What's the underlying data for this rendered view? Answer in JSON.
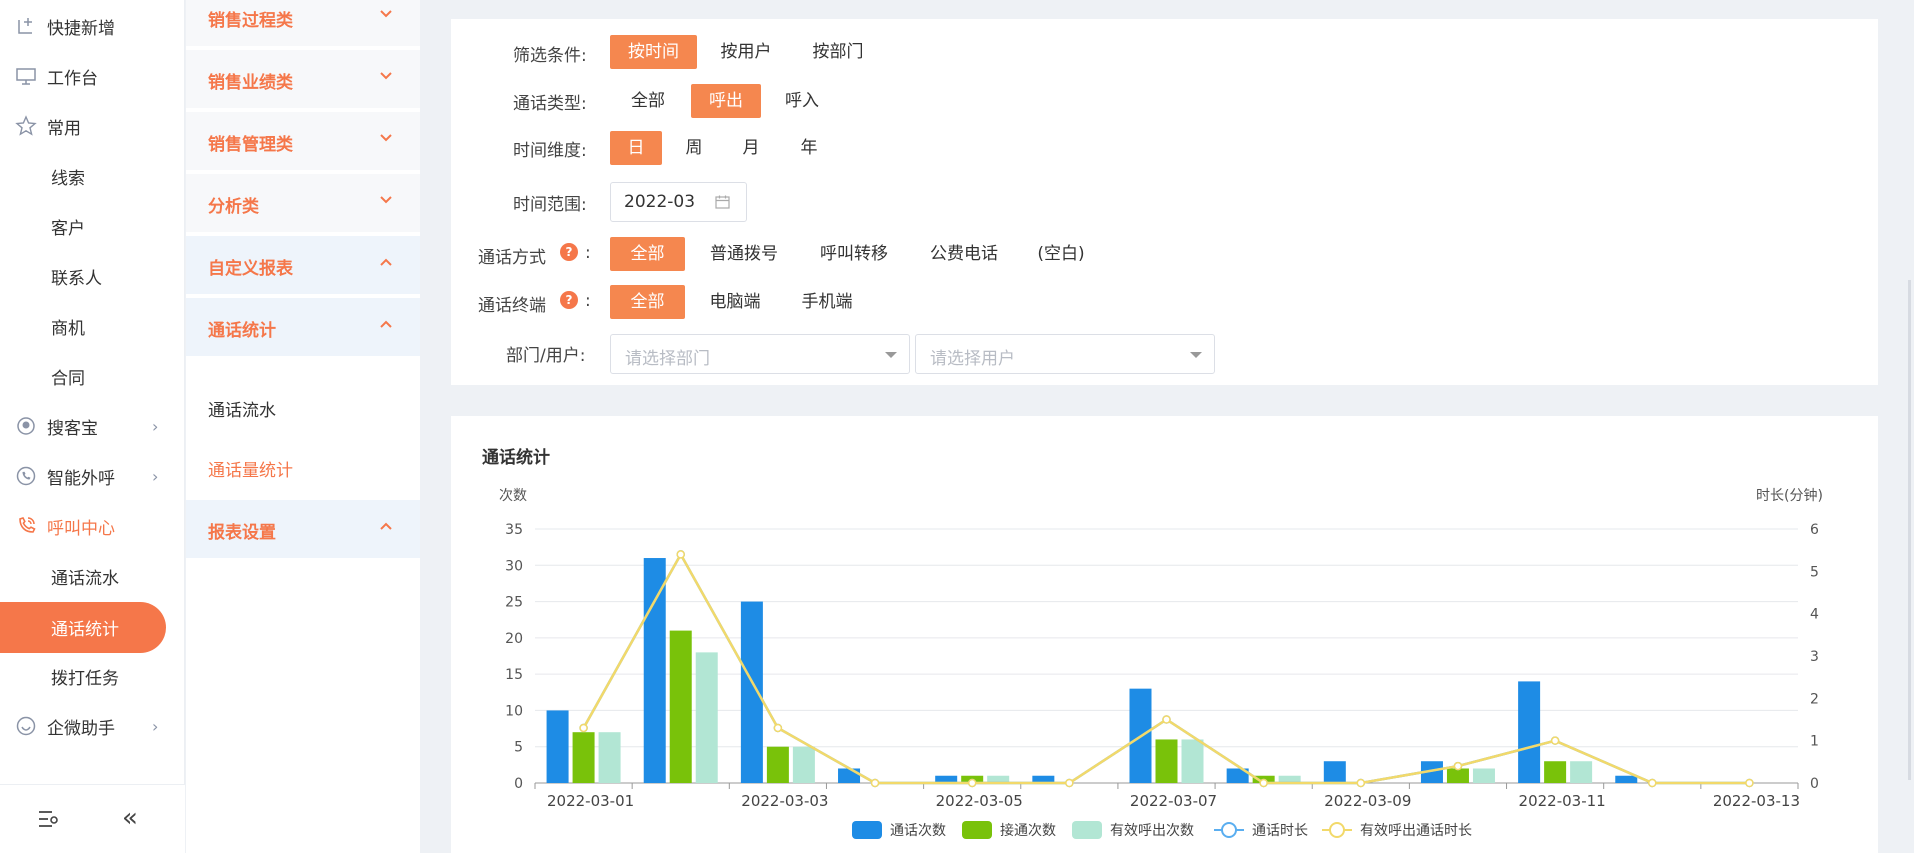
{
  "nav": {
    "items": [
      {
        "label": "快捷新增",
        "icon": "add-doc-icon"
      },
      {
        "label": "工作台",
        "icon": "monitor-icon"
      },
      {
        "label": "常用",
        "icon": "star-icon"
      },
      {
        "label": "线索"
      },
      {
        "label": "客户"
      },
      {
        "label": "联系人"
      },
      {
        "label": "商机"
      },
      {
        "label": "合同"
      },
      {
        "label": "搜客宝",
        "icon": "search-treasure-icon",
        "arrow": "›"
      },
      {
        "label": "智能外呼",
        "icon": "phone-icon",
        "arrow": "›"
      },
      {
        "label": "呼叫中心",
        "icon": "call-center-icon"
      },
      {
        "label": "通话流水"
      },
      {
        "label": "通话统计"
      },
      {
        "label": "拨打任务"
      },
      {
        "label": "企微助手",
        "icon": "wecom-icon",
        "arrow": "›"
      }
    ]
  },
  "panel": {
    "categories": [
      {
        "label": "销售过程类",
        "state": "collapsed"
      },
      {
        "label": "销售业绩类",
        "state": "collapsed"
      },
      {
        "label": "销售管理类",
        "state": "collapsed"
      },
      {
        "label": "分析类",
        "state": "collapsed"
      },
      {
        "label": "自定义报表",
        "state": "expanded"
      },
      {
        "label": "通话统计",
        "state": "expanded"
      },
      {
        "label": "报表设置",
        "state": "expanded"
      }
    ],
    "sub_items": [
      "通话流水",
      "通话量统计"
    ]
  },
  "filters": {
    "condition": {
      "label": "筛选条件:",
      "options": [
        "按时间",
        "按用户",
        "按部门"
      ],
      "selected": "按时间"
    },
    "call_type": {
      "label": "通话类型:",
      "options": [
        "全部",
        "呼出",
        "呼入"
      ],
      "selected": "呼出"
    },
    "time_dim": {
      "label": "时间维度:",
      "options": [
        "日",
        "周",
        "月",
        "年"
      ],
      "selected": "日"
    },
    "time_range": {
      "label": "时间范围:",
      "value": "2022-03"
    },
    "call_method": {
      "label": "通话方式",
      "options": [
        "全部",
        "普通拨号",
        "呼叫转移",
        "公费电话",
        "(空白)"
      ],
      "selected": "全部"
    },
    "call_terminal": {
      "label": "通话终端",
      "options": [
        "全部",
        "电脑端",
        "手机端"
      ],
      "selected": "全部"
    },
    "dept_user": {
      "label": "部门/用户:",
      "dept_placeholder": "请选择部门",
      "user_placeholder": "请选择用户"
    },
    "colon": ":",
    "help": "?"
  },
  "chart_title": "通话统计",
  "chart_data": {
    "type": "bar",
    "x": [
      "2022-03-01",
      "2022-03-02",
      "2022-03-03",
      "2022-03-04",
      "2022-03-05",
      "2022-03-06",
      "2022-03-07",
      "2022-03-08",
      "2022-03-09",
      "2022-03-10",
      "2022-03-11",
      "2022-03-12",
      "2022-03-13"
    ],
    "x_tick_labels": [
      "2022-03-01",
      "2022-03-03",
      "2022-03-05",
      "2022-03-07",
      "2022-03-09",
      "2022-03-11",
      "2022-03-13"
    ],
    "ylabel": "次数",
    "y2label": "时长(分钟)",
    "ylim": [
      0,
      35
    ],
    "y_ticks": [
      0,
      5,
      10,
      15,
      20,
      25,
      30,
      35
    ],
    "y2lim": [
      0,
      6
    ],
    "y2_ticks": [
      0,
      1,
      2,
      3,
      4,
      5,
      6
    ],
    "grid": true,
    "legend_position": "bottom",
    "series": [
      {
        "name": "通话次数",
        "type": "bar",
        "axis": "left",
        "color": "#1e8ce5",
        "values": [
          10,
          31,
          25,
          2,
          1,
          1,
          13,
          2,
          3,
          3,
          14,
          1,
          0
        ]
      },
      {
        "name": "接通次数",
        "type": "bar",
        "axis": "left",
        "color": "#79c20a",
        "values": [
          7,
          21,
          5,
          0,
          1,
          0,
          6,
          1,
          0,
          2,
          3,
          0,
          0
        ]
      },
      {
        "name": "有效呼出次数",
        "type": "bar",
        "axis": "left",
        "color": "#b2e6d4",
        "values": [
          7,
          18,
          5,
          0,
          1,
          0,
          6,
          1,
          0,
          2,
          3,
          0,
          0
        ]
      },
      {
        "name": "通话时长",
        "type": "line",
        "axis": "right",
        "color": "#5aaef0",
        "values": [
          1.3,
          5.4,
          1.3,
          0,
          0,
          0,
          1.5,
          0,
          0,
          0.4,
          1.0,
          0,
          0
        ]
      },
      {
        "name": "有效呼出通话时长",
        "type": "line",
        "axis": "right",
        "color": "#f2d96a",
        "values": [
          1.3,
          5.4,
          1.3,
          0,
          0,
          0,
          1.5,
          0,
          0,
          0.4,
          1.0,
          0,
          0
        ]
      }
    ]
  }
}
